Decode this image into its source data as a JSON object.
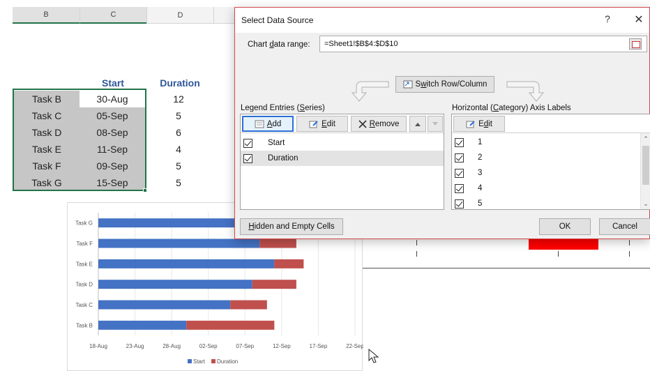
{
  "sheet": {
    "columns": [
      "B",
      "C",
      "D"
    ],
    "headers": {
      "start": "Start",
      "duration": "Duration"
    },
    "rows": [
      {
        "task": "Task B",
        "start": "30-Aug",
        "duration": "12"
      },
      {
        "task": "Task C",
        "start": "05-Sep",
        "duration": "5"
      },
      {
        "task": "Task D",
        "start": "08-Sep",
        "duration": "6"
      },
      {
        "task": "Task E",
        "start": "11-Sep",
        "duration": "4"
      },
      {
        "task": "Task F",
        "start": "09-Sep",
        "duration": "5"
      },
      {
        "task": "Task G",
        "start": "15-Sep",
        "duration": "5"
      }
    ]
  },
  "dialog": {
    "title": "Select Data Source",
    "help": "?",
    "close": "✕",
    "range_label": "Chart data range:",
    "range_value": "=Sheet1!$B$4:$D$10",
    "switch_label": "Switch Row/Column",
    "legend_label": "Legend Entries (Series)",
    "axis_label": "Horizontal (Category) Axis Labels",
    "legend_buttons": {
      "add": "Add",
      "edit": "Edit",
      "remove": "Remove"
    },
    "axis_buttons": {
      "edit": "Edit"
    },
    "series": [
      "Start",
      "Duration"
    ],
    "axis_items": [
      "1",
      "2",
      "3",
      "4",
      "5"
    ],
    "hidden_cells": "Hidden and Empty Cells",
    "ok": "OK",
    "cancel": "Cancel"
  },
  "colors": {
    "start": "#4472c4",
    "duration": "#c0504d",
    "selection": "#217346",
    "accent_red": "#ff0000"
  },
  "chart_data": {
    "type": "bar",
    "orientation": "horizontal-stacked",
    "categories": [
      "Task G",
      "Task F",
      "Task E",
      "Task D",
      "Task C",
      "Task B"
    ],
    "series": [
      {
        "name": "Start",
        "values": [
          "15-Sep",
          "09-Sep",
          "11-Sep",
          "08-Sep",
          "05-Sep",
          "30-Aug"
        ]
      },
      {
        "name": "Duration",
        "values": [
          5,
          5,
          4,
          6,
          5,
          12
        ]
      }
    ],
    "x_ticks": [
      "18-Aug",
      "23-Aug",
      "28-Aug",
      "02-Sep",
      "07-Sep",
      "12-Sep",
      "17-Sep",
      "22-Sep"
    ],
    "xlim": [
      "18-Aug",
      "22-Sep"
    ],
    "legend": [
      "Start",
      "Duration"
    ],
    "legend_position": "bottom"
  }
}
